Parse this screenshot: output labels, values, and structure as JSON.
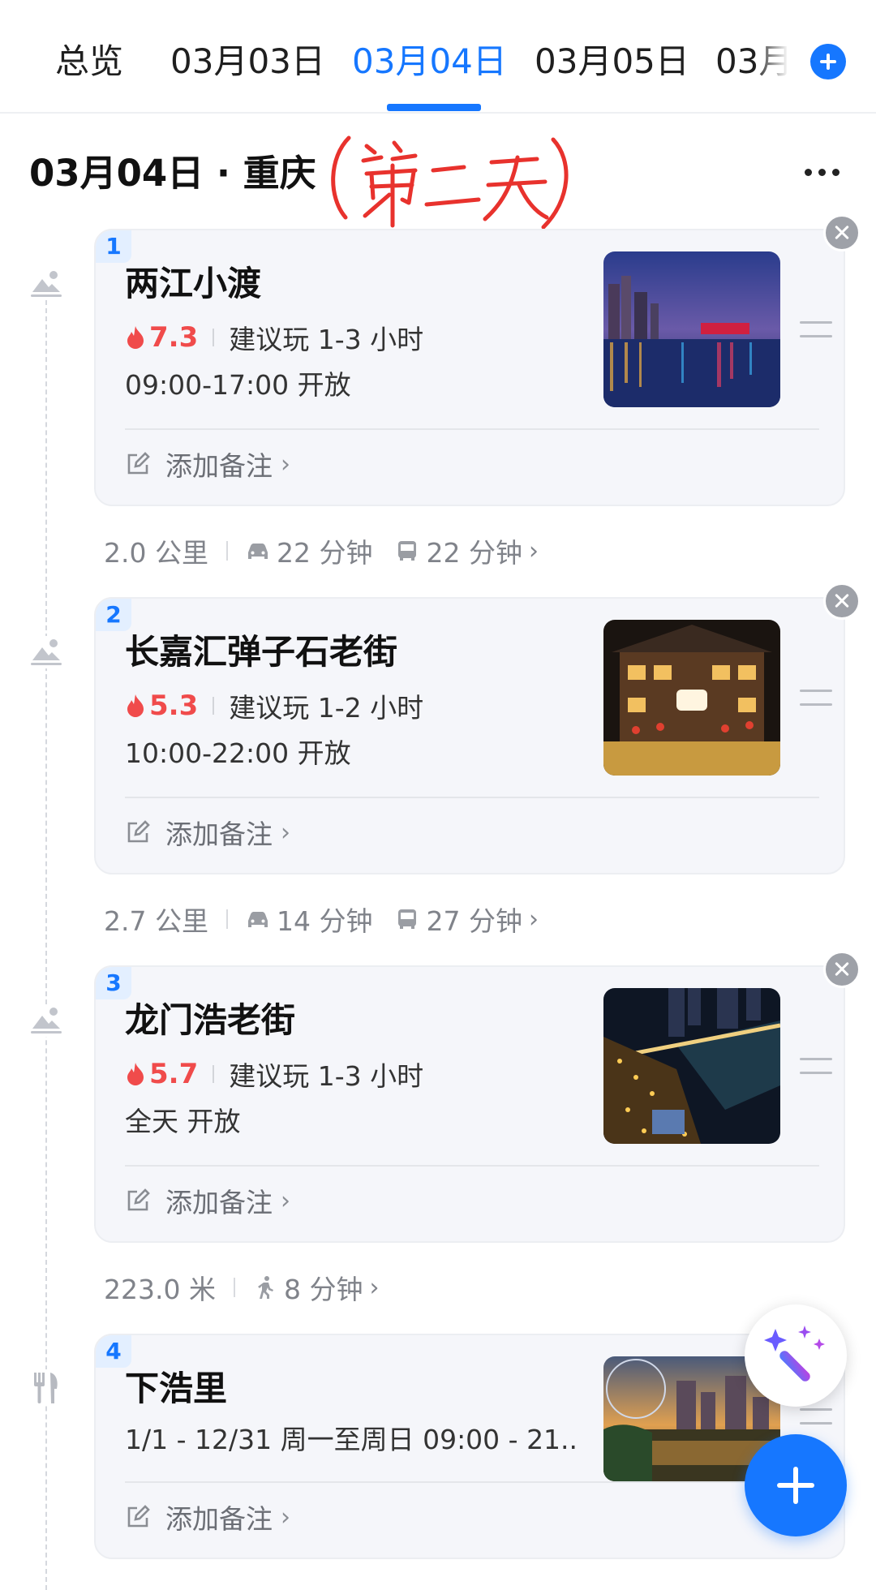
{
  "tabs": {
    "overview": "总览",
    "days": [
      "03月03日",
      "03月04日",
      "03月05日",
      "03月"
    ],
    "active_index": 1,
    "accent_color": "#1677ff",
    "add_icon": "plus-circle-icon"
  },
  "day_header": {
    "title": "03月04日 · 重庆",
    "handwritten_note": "(第二天)",
    "more_icon": "more-dots-icon"
  },
  "places": [
    {
      "index": "1",
      "name": "两江小渡",
      "rating": "7.3",
      "suggest": "建议玩 1-3 小时",
      "hours": "09:00-17:00 开放",
      "note": "添加备注",
      "type_icon": "attraction-icon"
    },
    {
      "index": "2",
      "name": "长嘉汇弹子石老街",
      "rating": "5.3",
      "suggest": "建议玩 1-2 小时",
      "hours": "10:00-22:00 开放",
      "note": "添加备注",
      "type_icon": "attraction-icon"
    },
    {
      "index": "3",
      "name": "龙门浩老街",
      "rating": "5.7",
      "suggest": "建议玩 1-3 小时",
      "hours": "全天 开放",
      "note": "添加备注",
      "type_icon": "attraction-icon"
    },
    {
      "index": "4",
      "name": "下浩里",
      "hours": "1/1 - 12/31 周一至周日 09:00 - 21...",
      "note": "添加备注",
      "type_icon": "restaurant-icon"
    }
  ],
  "transports": [
    {
      "distance": "2.0 公里",
      "car": "22 分钟",
      "bus": "22 分钟"
    },
    {
      "distance": "2.7 公里",
      "car": "14 分钟",
      "bus": "27 分钟"
    },
    {
      "distance": "223.0 米",
      "walk": "8 分钟"
    }
  ],
  "fabs": {
    "magic_icon": "magic-wand-icon",
    "add_icon": "plus-icon"
  }
}
